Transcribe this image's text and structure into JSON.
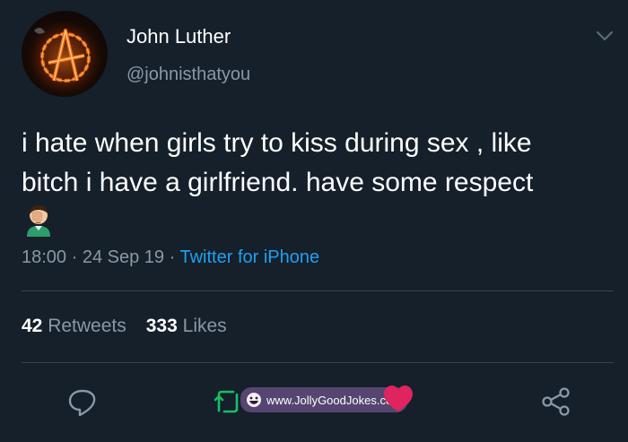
{
  "author": {
    "display_name": "John Luther",
    "handle": "@johnisthatyou",
    "avatar_icon": "fiery-anarchy-symbol-avatar"
  },
  "tweet": {
    "lines": [
      "i hate when girls try to kiss during sex , like",
      "bitch i have a girlfriend. have some respect"
    ],
    "emoji": "face-palm-emoji"
  },
  "meta": {
    "time": "18:00",
    "separator": "·",
    "date": "24 Sep 19",
    "source": "Twitter for iPhone"
  },
  "stats": {
    "retweets_count": "42",
    "retweets_label": "Retweets",
    "likes_count": "333",
    "likes_label": "Likes"
  },
  "actions": {
    "reply_icon": "reply-icon",
    "retweet_icon": "retweet-icon",
    "like_icon": "heart-icon",
    "share_icon": "share-icon"
  },
  "watermark": {
    "text": "www.JollyGoodJokes.com"
  },
  "colors": {
    "background": "#15202b",
    "secondary_text": "#8b98a5",
    "link": "#1da1f2",
    "retweet": "#17bf63",
    "like": "#e0245e",
    "divider": "#38444d"
  }
}
